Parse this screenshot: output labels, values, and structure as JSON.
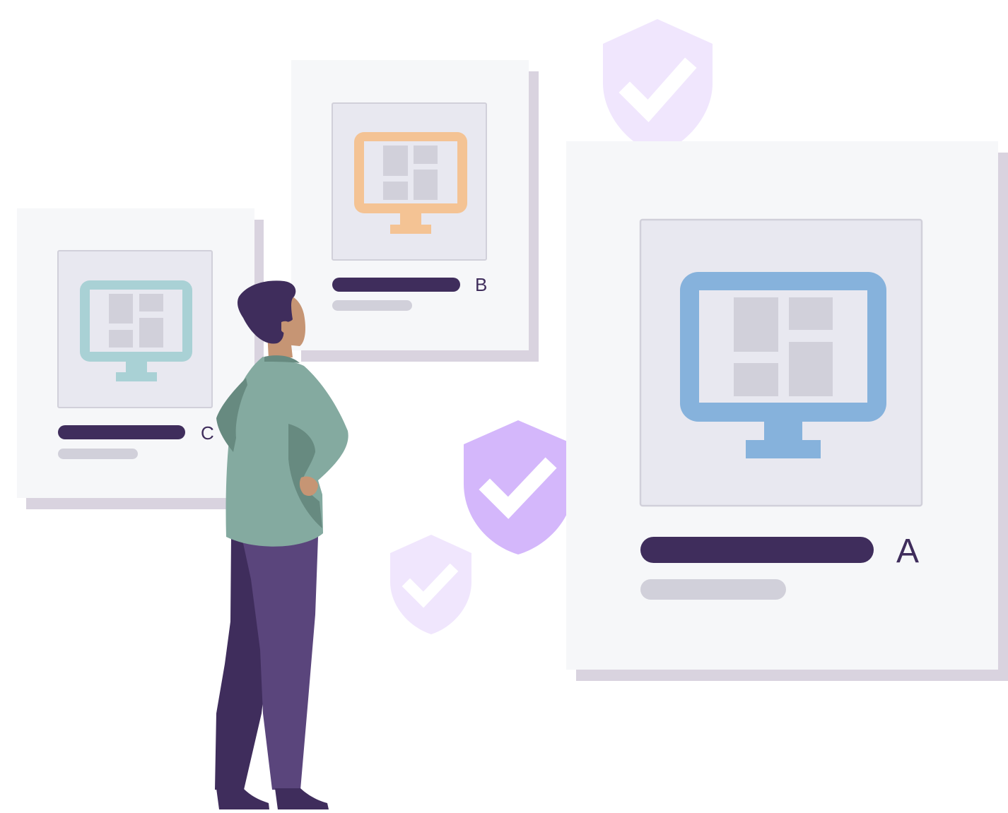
{
  "colors": {
    "background": "#ffffff",
    "card": "#f6f7f9",
    "card_shadow": "#d9d3df",
    "frame": "#e8e8f0",
    "frame_border": "#d1d0da",
    "screen_panel": "#d1d0da",
    "title_bar": "#3f2d5c",
    "subtitle_bar": "#d1d0da",
    "monitor_teal": "#a9d1d5",
    "monitor_orange": "#f4c394",
    "monitor_blue": "#86b2dc",
    "shield_light": "#f0e6fd",
    "shield_medium": "#d4b7fb",
    "check": "#ffffff",
    "skin": "#c69574",
    "hair": "#3f2d5c",
    "shirt": "#84aaa0",
    "shirt_shadow": "#678a80",
    "pants_front": "#5a457c",
    "pants_back": "#3f2d5c",
    "shoes": "#3f2d5c"
  },
  "cards": [
    {
      "id": "card-c",
      "label": "C",
      "icon": "monitor-icon",
      "monitor_color": "teal"
    },
    {
      "id": "card-b",
      "label": "B",
      "icon": "monitor-icon",
      "monitor_color": "orange"
    },
    {
      "id": "card-a",
      "label": "A",
      "icon": "monitor-icon",
      "monitor_color": "blue"
    }
  ],
  "shields": [
    {
      "icon": "shield-check-icon",
      "tone": "light"
    },
    {
      "icon": "shield-check-icon",
      "tone": "medium"
    },
    {
      "icon": "shield-check-icon",
      "tone": "light"
    }
  ],
  "figure": {
    "icon": "person-standing-icon"
  }
}
